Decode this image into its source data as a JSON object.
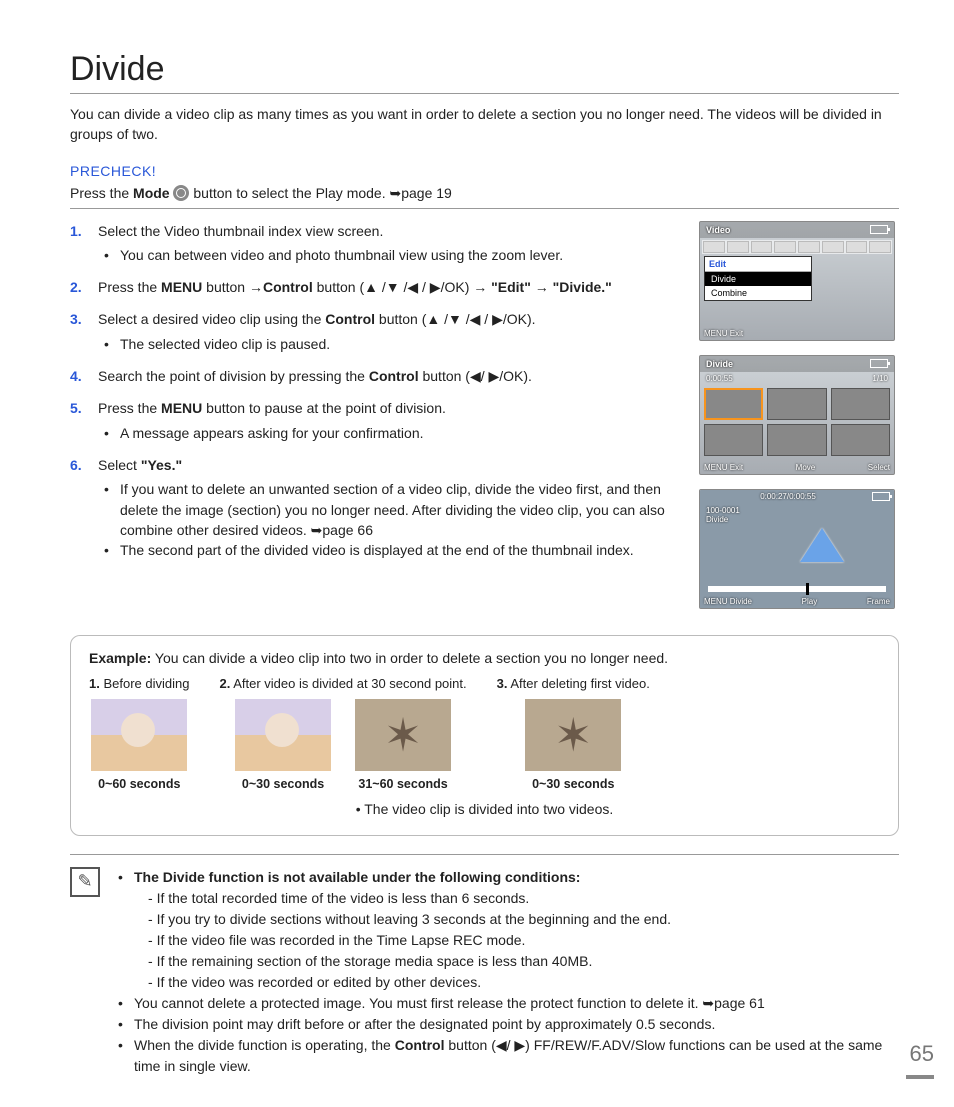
{
  "title": "Divide",
  "intro": "You can divide a video clip as many times as you want in order to delete a section you no longer need. The videos will be divided in groups of two.",
  "precheck": {
    "label": "PRECHECK!",
    "text_before": "Press the ",
    "mode_word": "Mode",
    "text_after": " button to select the Play mode. ➥page 19"
  },
  "steps": [
    {
      "num": "1.",
      "text": "Select the Video thumbnail index view screen.",
      "bullets": [
        "You can between video and photo thumbnail view using the zoom lever."
      ]
    },
    {
      "num": "2.",
      "html": "Press the <b>MENU</b> button →<b>Control</b> button (▲ /▼ /◀ / ▶/OK) → <b>\"Edit\"</b> → <b>\"Divide.\"</b>"
    },
    {
      "num": "3.",
      "html": "Select a desired video clip using the <b>Control</b> button (▲ /▼ /◀ / ▶/OK).",
      "bullets": [
        "The selected video clip is paused."
      ]
    },
    {
      "num": "4.",
      "html": "Search the point of division by pressing the <b>Control</b> button (◀/ ▶/OK)."
    },
    {
      "num": "5.",
      "html": "Press the <b>MENU</b> button to pause at the point of division.",
      "bullets": [
        "A message appears asking for your confirmation."
      ]
    },
    {
      "num": "6.",
      "html": "Select <b>\"Yes.\"</b>",
      "bullets": [
        "If you want to delete an unwanted section of a video clip, divide the video first, and then delete the image (section) you no longer need. After dividing the video clip, you can also combine other desired videos. ➥page 66",
        "The second part of the divided video is displayed at the end of the thumbnail index."
      ]
    }
  ],
  "side": {
    "s1": {
      "title": "Video",
      "menu_header": "Edit",
      "item_sel": "Divide",
      "item2": "Combine",
      "foot": "MENU Exit"
    },
    "s2": {
      "title": "Divide",
      "time": "0:00:55",
      "count": "1/10",
      "foot_l": "MENU Exit",
      "foot_m": "Move",
      "foot_r": "Select"
    },
    "s3": {
      "time": "0:00:27/0:00:55",
      "file": "100-0001",
      "label": "Divide",
      "foot_l": "MENU Divide",
      "foot_m": "Play",
      "foot_r": "Frame"
    }
  },
  "example": {
    "title_bold": "Example:",
    "title_rest": " You can divide a video clip into two in order to delete a section you no longer need.",
    "cols": [
      {
        "n": "1.",
        "head": "Before dividing",
        "imgs": [
          {
            "cls": "baby",
            "cap": "0~60 seconds"
          }
        ]
      },
      {
        "n": "2.",
        "head": "After video is divided at 30 second point.",
        "imgs": [
          {
            "cls": "baby",
            "cap": "0~30 seconds"
          },
          {
            "cls": "star",
            "cap": "31~60 seconds"
          }
        ]
      },
      {
        "n": "3.",
        "head": "After deleting first video.",
        "imgs": [
          {
            "cls": "star",
            "cap": "0~30 seconds"
          }
        ]
      }
    ],
    "note": "The video clip is divided into two videos."
  },
  "notes": {
    "lead_bold": "The Divide function is not available under the following conditions:",
    "conds": [
      "If the total recorded time of the video is less than 6 seconds.",
      "If you try to divide sections without leaving 3 seconds at the beginning and the end.",
      "If the video file was recorded in the Time Lapse REC mode.",
      "If the remaining section of the storage media space is less than 40MB.",
      "If the video was recorded or edited by other devices."
    ],
    "items": [
      "You cannot delete a protected image. You must first release the protect function to delete it. ➥page 61",
      "The division point may drift before or after the designated point by approximately 0.5 seconds.",
      "When the divide function is operating, the <b>Control</b> button (◀/ ▶) FF/REW/F.ADV/Slow functions can be used at the same time in single view."
    ]
  },
  "page_number": "65"
}
